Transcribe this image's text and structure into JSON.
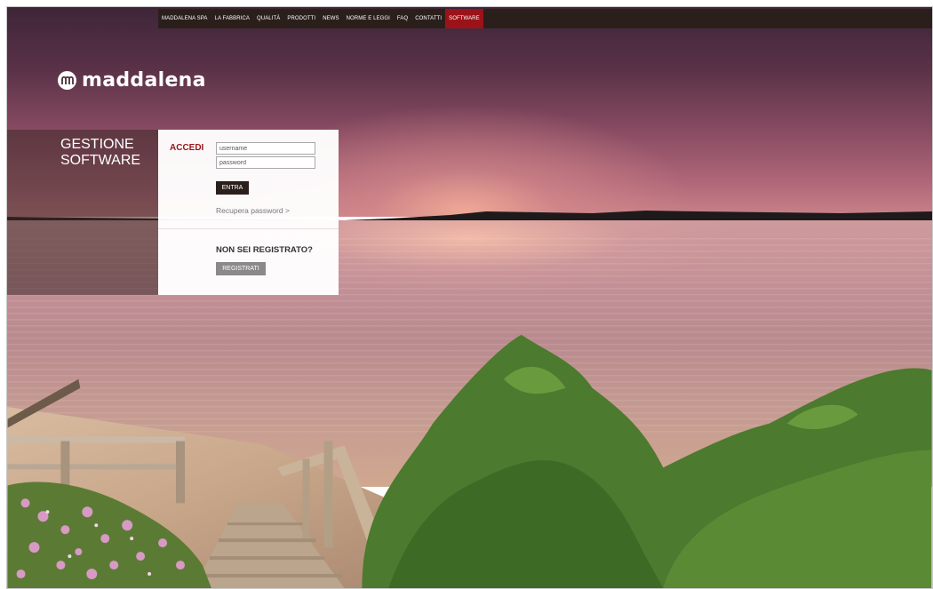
{
  "nav": {
    "items": [
      {
        "label": "MADDALENA SPA"
      },
      {
        "label": "LA FABBRICA"
      },
      {
        "label": "QUALITÀ"
      },
      {
        "label": "PRODOTTI"
      },
      {
        "label": "NEWS"
      },
      {
        "label": "NORME E LEGGI"
      },
      {
        "label": "FAQ"
      },
      {
        "label": "CONTATTI"
      },
      {
        "label": "SOFTWARE",
        "active": true
      }
    ]
  },
  "brand": {
    "name": "maddalena"
  },
  "section": {
    "title_line1": "GESTIONE",
    "title_line2": "SOFTWARE"
  },
  "login": {
    "heading": "ACCEDI",
    "username_placeholder": "username",
    "password_placeholder": "password",
    "submit_label": "ENTRA",
    "recover_link": "Recupera password >"
  },
  "register": {
    "heading": "NON SEI REGISTRATO?",
    "button_label": "REGISTRATI"
  },
  "colors": {
    "accent": "#9b1319",
    "nav_bg": "#2b1f1c",
    "register_btn": "#8a8a8a"
  }
}
